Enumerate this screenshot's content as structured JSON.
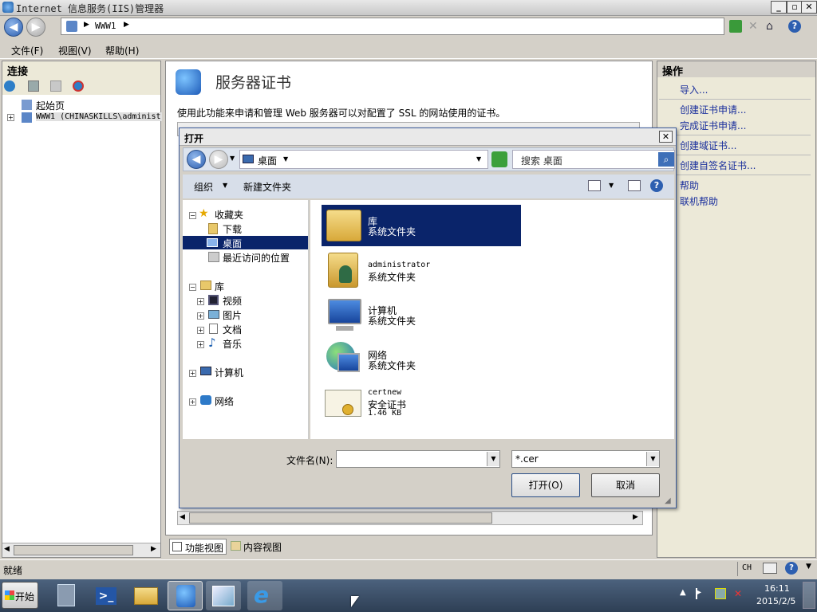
{
  "window": {
    "title": "Internet 信息服务(IIS)管理器"
  },
  "address": {
    "crumb": "WWW1"
  },
  "menu": {
    "file": "文件(F)",
    "view": "视图(V)",
    "help": "帮助(H)"
  },
  "left": {
    "title": "连接",
    "tree": [
      {
        "label": "起始页"
      },
      {
        "label": "WWW1 (CHINASKILLS\\administ"
      }
    ]
  },
  "center": {
    "heading": "服务器证书",
    "description": "使用此功能来申请和管理 Web 服务器可以对配置了 SSL 的网站使用的证书。",
    "view_tabs": [
      "功能视图",
      "内容视图"
    ]
  },
  "right": {
    "title": "操作",
    "actions": [
      "导入...",
      "创建证书申请...",
      "完成证书申请...",
      "创建域证书...",
      "创建自签名证书...",
      "帮助",
      "联机帮助"
    ]
  },
  "dialog": {
    "title": "打开",
    "location": "桌面",
    "search_placeholder": "搜索 桌面",
    "organize": "组织",
    "new_folder": "新建文件夹",
    "nav": {
      "favorites": "收藏夹",
      "downloads": "下载",
      "desktop": "桌面",
      "recent": "最近访问的位置",
      "libraries": "库",
      "videos": "视频",
      "pictures": "图片",
      "documents": "文档",
      "music": "音乐",
      "computer": "计算机",
      "network": "网络"
    },
    "files": [
      {
        "name": "库",
        "type": "系统文件夹",
        "size": ""
      },
      {
        "name": "administrator",
        "type": "系统文件夹",
        "size": ""
      },
      {
        "name": "计算机",
        "type": "系统文件夹",
        "size": ""
      },
      {
        "name": "网络",
        "type": "系统文件夹",
        "size": ""
      },
      {
        "name": "certnew",
        "type": "安全证书",
        "size": "1.46 KB"
      }
    ],
    "filename_label": "文件名(N):",
    "filename_value": "",
    "filter_value": "*.cer",
    "open_button": "打开(O)",
    "cancel_button": "取消"
  },
  "status": {
    "text": "就绪"
  },
  "taskbar": {
    "start": "开始",
    "lang": "CH",
    "time": "16:11",
    "date": "2015/2/5"
  },
  "colors": {
    "selection": "#0a246a",
    "link": "#1a2f9c",
    "taskbar": "#3b4e68"
  }
}
